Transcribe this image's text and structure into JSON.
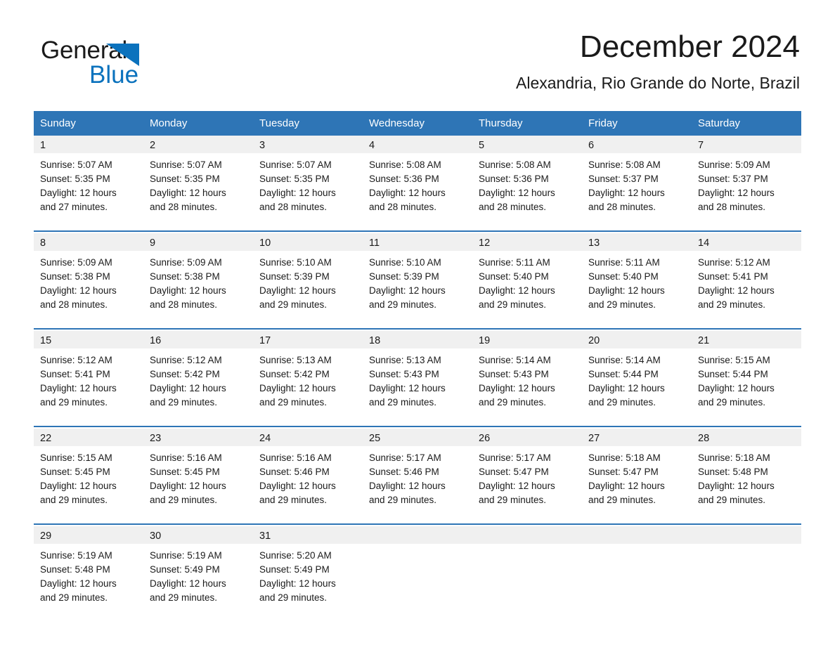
{
  "brand": {
    "name_part1": "General",
    "name_part2": "Blue",
    "triangle_color": "#0b72bd",
    "accent_color": "#2e75b6"
  },
  "header": {
    "month_title": "December 2024",
    "location": "Alexandria, Rio Grande do Norte, Brazil"
  },
  "calendar": {
    "weekday_headers": [
      "Sunday",
      "Monday",
      "Tuesday",
      "Wednesday",
      "Thursday",
      "Friday",
      "Saturday"
    ],
    "weeks": [
      [
        {
          "day": "1",
          "sunrise": "Sunrise: 5:07 AM",
          "sunset": "Sunset: 5:35 PM",
          "daylight_line1": "Daylight: 12 hours",
          "daylight_line2": "and 27 minutes."
        },
        {
          "day": "2",
          "sunrise": "Sunrise: 5:07 AM",
          "sunset": "Sunset: 5:35 PM",
          "daylight_line1": "Daylight: 12 hours",
          "daylight_line2": "and 28 minutes."
        },
        {
          "day": "3",
          "sunrise": "Sunrise: 5:07 AM",
          "sunset": "Sunset: 5:35 PM",
          "daylight_line1": "Daylight: 12 hours",
          "daylight_line2": "and 28 minutes."
        },
        {
          "day": "4",
          "sunrise": "Sunrise: 5:08 AM",
          "sunset": "Sunset: 5:36 PM",
          "daylight_line1": "Daylight: 12 hours",
          "daylight_line2": "and 28 minutes."
        },
        {
          "day": "5",
          "sunrise": "Sunrise: 5:08 AM",
          "sunset": "Sunset: 5:36 PM",
          "daylight_line1": "Daylight: 12 hours",
          "daylight_line2": "and 28 minutes."
        },
        {
          "day": "6",
          "sunrise": "Sunrise: 5:08 AM",
          "sunset": "Sunset: 5:37 PM",
          "daylight_line1": "Daylight: 12 hours",
          "daylight_line2": "and 28 minutes."
        },
        {
          "day": "7",
          "sunrise": "Sunrise: 5:09 AM",
          "sunset": "Sunset: 5:37 PM",
          "daylight_line1": "Daylight: 12 hours",
          "daylight_line2": "and 28 minutes."
        }
      ],
      [
        {
          "day": "8",
          "sunrise": "Sunrise: 5:09 AM",
          "sunset": "Sunset: 5:38 PM",
          "daylight_line1": "Daylight: 12 hours",
          "daylight_line2": "and 28 minutes."
        },
        {
          "day": "9",
          "sunrise": "Sunrise: 5:09 AM",
          "sunset": "Sunset: 5:38 PM",
          "daylight_line1": "Daylight: 12 hours",
          "daylight_line2": "and 28 minutes."
        },
        {
          "day": "10",
          "sunrise": "Sunrise: 5:10 AM",
          "sunset": "Sunset: 5:39 PM",
          "daylight_line1": "Daylight: 12 hours",
          "daylight_line2": "and 29 minutes."
        },
        {
          "day": "11",
          "sunrise": "Sunrise: 5:10 AM",
          "sunset": "Sunset: 5:39 PM",
          "daylight_line1": "Daylight: 12 hours",
          "daylight_line2": "and 29 minutes."
        },
        {
          "day": "12",
          "sunrise": "Sunrise: 5:11 AM",
          "sunset": "Sunset: 5:40 PM",
          "daylight_line1": "Daylight: 12 hours",
          "daylight_line2": "and 29 minutes."
        },
        {
          "day": "13",
          "sunrise": "Sunrise: 5:11 AM",
          "sunset": "Sunset: 5:40 PM",
          "daylight_line1": "Daylight: 12 hours",
          "daylight_line2": "and 29 minutes."
        },
        {
          "day": "14",
          "sunrise": "Sunrise: 5:12 AM",
          "sunset": "Sunset: 5:41 PM",
          "daylight_line1": "Daylight: 12 hours",
          "daylight_line2": "and 29 minutes."
        }
      ],
      [
        {
          "day": "15",
          "sunrise": "Sunrise: 5:12 AM",
          "sunset": "Sunset: 5:41 PM",
          "daylight_line1": "Daylight: 12 hours",
          "daylight_line2": "and 29 minutes."
        },
        {
          "day": "16",
          "sunrise": "Sunrise: 5:12 AM",
          "sunset": "Sunset: 5:42 PM",
          "daylight_line1": "Daylight: 12 hours",
          "daylight_line2": "and 29 minutes."
        },
        {
          "day": "17",
          "sunrise": "Sunrise: 5:13 AM",
          "sunset": "Sunset: 5:42 PM",
          "daylight_line1": "Daylight: 12 hours",
          "daylight_line2": "and 29 minutes."
        },
        {
          "day": "18",
          "sunrise": "Sunrise: 5:13 AM",
          "sunset": "Sunset: 5:43 PM",
          "daylight_line1": "Daylight: 12 hours",
          "daylight_line2": "and 29 minutes."
        },
        {
          "day": "19",
          "sunrise": "Sunrise: 5:14 AM",
          "sunset": "Sunset: 5:43 PM",
          "daylight_line1": "Daylight: 12 hours",
          "daylight_line2": "and 29 minutes."
        },
        {
          "day": "20",
          "sunrise": "Sunrise: 5:14 AM",
          "sunset": "Sunset: 5:44 PM",
          "daylight_line1": "Daylight: 12 hours",
          "daylight_line2": "and 29 minutes."
        },
        {
          "day": "21",
          "sunrise": "Sunrise: 5:15 AM",
          "sunset": "Sunset: 5:44 PM",
          "daylight_line1": "Daylight: 12 hours",
          "daylight_line2": "and 29 minutes."
        }
      ],
      [
        {
          "day": "22",
          "sunrise": "Sunrise: 5:15 AM",
          "sunset": "Sunset: 5:45 PM",
          "daylight_line1": "Daylight: 12 hours",
          "daylight_line2": "and 29 minutes."
        },
        {
          "day": "23",
          "sunrise": "Sunrise: 5:16 AM",
          "sunset": "Sunset: 5:45 PM",
          "daylight_line1": "Daylight: 12 hours",
          "daylight_line2": "and 29 minutes."
        },
        {
          "day": "24",
          "sunrise": "Sunrise: 5:16 AM",
          "sunset": "Sunset: 5:46 PM",
          "daylight_line1": "Daylight: 12 hours",
          "daylight_line2": "and 29 minutes."
        },
        {
          "day": "25",
          "sunrise": "Sunrise: 5:17 AM",
          "sunset": "Sunset: 5:46 PM",
          "daylight_line1": "Daylight: 12 hours",
          "daylight_line2": "and 29 minutes."
        },
        {
          "day": "26",
          "sunrise": "Sunrise: 5:17 AM",
          "sunset": "Sunset: 5:47 PM",
          "daylight_line1": "Daylight: 12 hours",
          "daylight_line2": "and 29 minutes."
        },
        {
          "day": "27",
          "sunrise": "Sunrise: 5:18 AM",
          "sunset": "Sunset: 5:47 PM",
          "daylight_line1": "Daylight: 12 hours",
          "daylight_line2": "and 29 minutes."
        },
        {
          "day": "28",
          "sunrise": "Sunrise: 5:18 AM",
          "sunset": "Sunset: 5:48 PM",
          "daylight_line1": "Daylight: 12 hours",
          "daylight_line2": "and 29 minutes."
        }
      ],
      [
        {
          "day": "29",
          "sunrise": "Sunrise: 5:19 AM",
          "sunset": "Sunset: 5:48 PM",
          "daylight_line1": "Daylight: 12 hours",
          "daylight_line2": "and 29 minutes."
        },
        {
          "day": "30",
          "sunrise": "Sunrise: 5:19 AM",
          "sunset": "Sunset: 5:49 PM",
          "daylight_line1": "Daylight: 12 hours",
          "daylight_line2": "and 29 minutes."
        },
        {
          "day": "31",
          "sunrise": "Sunrise: 5:20 AM",
          "sunset": "Sunset: 5:49 PM",
          "daylight_line1": "Daylight: 12 hours",
          "daylight_line2": "and 29 minutes."
        },
        {
          "day": "",
          "sunrise": "",
          "sunset": "",
          "daylight_line1": "",
          "daylight_line2": ""
        },
        {
          "day": "",
          "sunrise": "",
          "sunset": "",
          "daylight_line1": "",
          "daylight_line2": ""
        },
        {
          "day": "",
          "sunrise": "",
          "sunset": "",
          "daylight_line1": "",
          "daylight_line2": ""
        },
        {
          "day": "",
          "sunrise": "",
          "sunset": "",
          "daylight_line1": "",
          "daylight_line2": ""
        }
      ]
    ]
  }
}
